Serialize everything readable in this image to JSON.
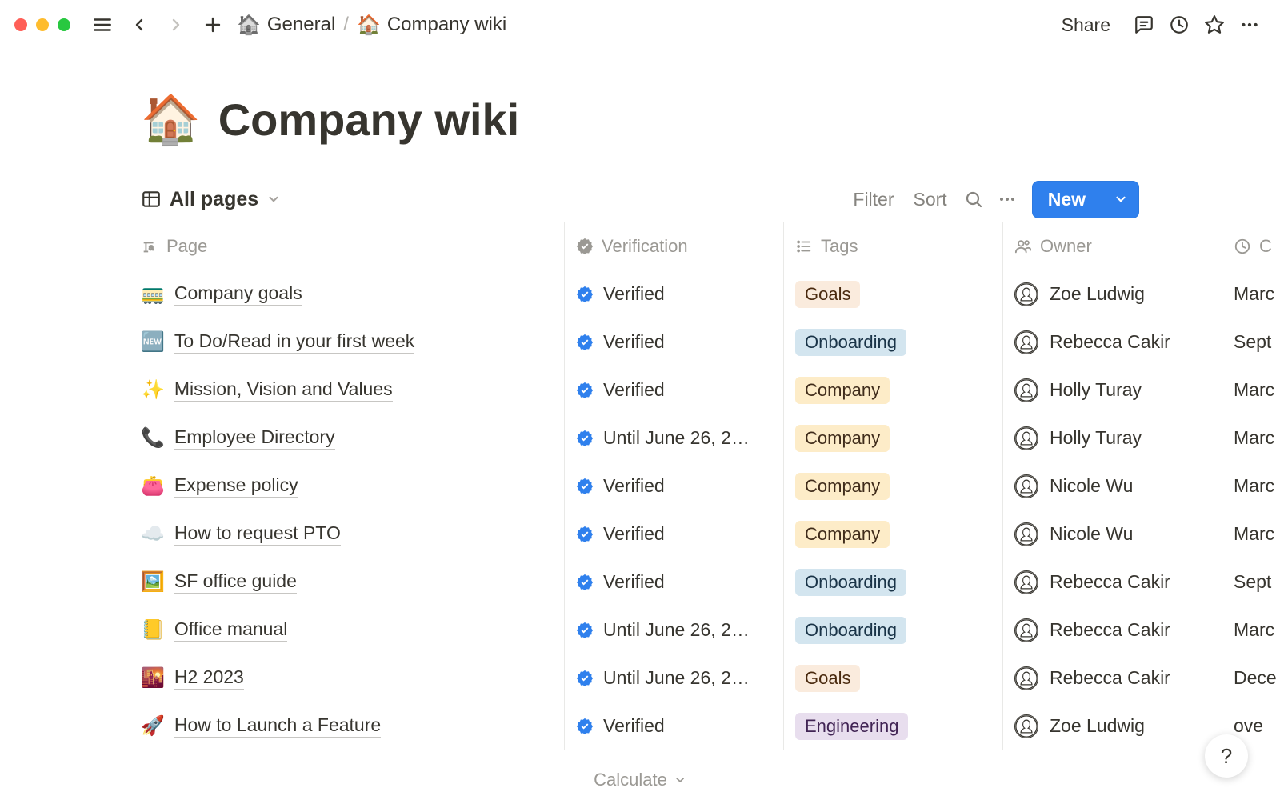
{
  "chrome": {
    "breadcrumb": {
      "root_icon": "🏠",
      "root_label": "General",
      "current_icon": "🏠",
      "current_label": "Company wiki"
    },
    "share_label": "Share"
  },
  "page": {
    "icon": "🏠",
    "title": "Company wiki"
  },
  "viewbar": {
    "tab_label": "All pages",
    "filter_label": "Filter",
    "sort_label": "Sort",
    "new_label": "New"
  },
  "columns": {
    "page": "Page",
    "verification": "Verification",
    "tags": "Tags",
    "owner": "Owner",
    "created_initial": "C"
  },
  "rows": [
    {
      "emoji": "🚃",
      "name": "Company goals",
      "verification": "Verified",
      "tag": "Goals",
      "tag_class": "tag-goals",
      "owner": "Zoe Ludwig",
      "date": "Marc"
    },
    {
      "emoji": "🆕",
      "name": "To Do/Read in your first week",
      "verification": "Verified",
      "tag": "Onboarding",
      "tag_class": "tag-onboarding",
      "owner": "Rebecca Cakir",
      "date": "Sept"
    },
    {
      "emoji": "✨",
      "name": "Mission, Vision and Values",
      "verification": "Verified",
      "tag": "Company",
      "tag_class": "tag-company",
      "owner": "Holly Turay",
      "date": "Marc"
    },
    {
      "emoji": "📞",
      "name": "Employee Directory",
      "verification": "Until June 26, 2…",
      "tag": "Company",
      "tag_class": "tag-company",
      "owner": "Holly Turay",
      "date": "Marc"
    },
    {
      "emoji": "👛",
      "name": "Expense policy",
      "verification": "Verified",
      "tag": "Company",
      "tag_class": "tag-company",
      "owner": "Nicole Wu",
      "date": "Marc"
    },
    {
      "emoji": "☁️",
      "name": "How to request PTO",
      "verification": "Verified",
      "tag": "Company",
      "tag_class": "tag-company",
      "owner": "Nicole Wu",
      "date": "Marc"
    },
    {
      "emoji": "🖼️",
      "name": "SF office guide",
      "verification": "Verified",
      "tag": "Onboarding",
      "tag_class": "tag-onboarding",
      "owner": "Rebecca Cakir",
      "date": "Sept"
    },
    {
      "emoji": "📒",
      "name": "Office manual",
      "verification": "Until June 26, 2…",
      "tag": "Onboarding",
      "tag_class": "tag-onboarding",
      "owner": "Rebecca Cakir",
      "date": "Marc"
    },
    {
      "emoji": "🌇",
      "name": "H2 2023",
      "verification": "Until June 26, 2…",
      "tag": "Goals",
      "tag_class": "tag-goals",
      "owner": "Rebecca Cakir",
      "date": "Dece"
    },
    {
      "emoji": "🚀",
      "name": "How to Launch a Feature",
      "verification": "Verified",
      "tag": "Engineering",
      "tag_class": "tag-engineering",
      "owner": "Zoe Ludwig",
      "date": "ove"
    }
  ],
  "footer": {
    "calculate_label": "Calculate"
  },
  "help": {
    "label": "?"
  }
}
